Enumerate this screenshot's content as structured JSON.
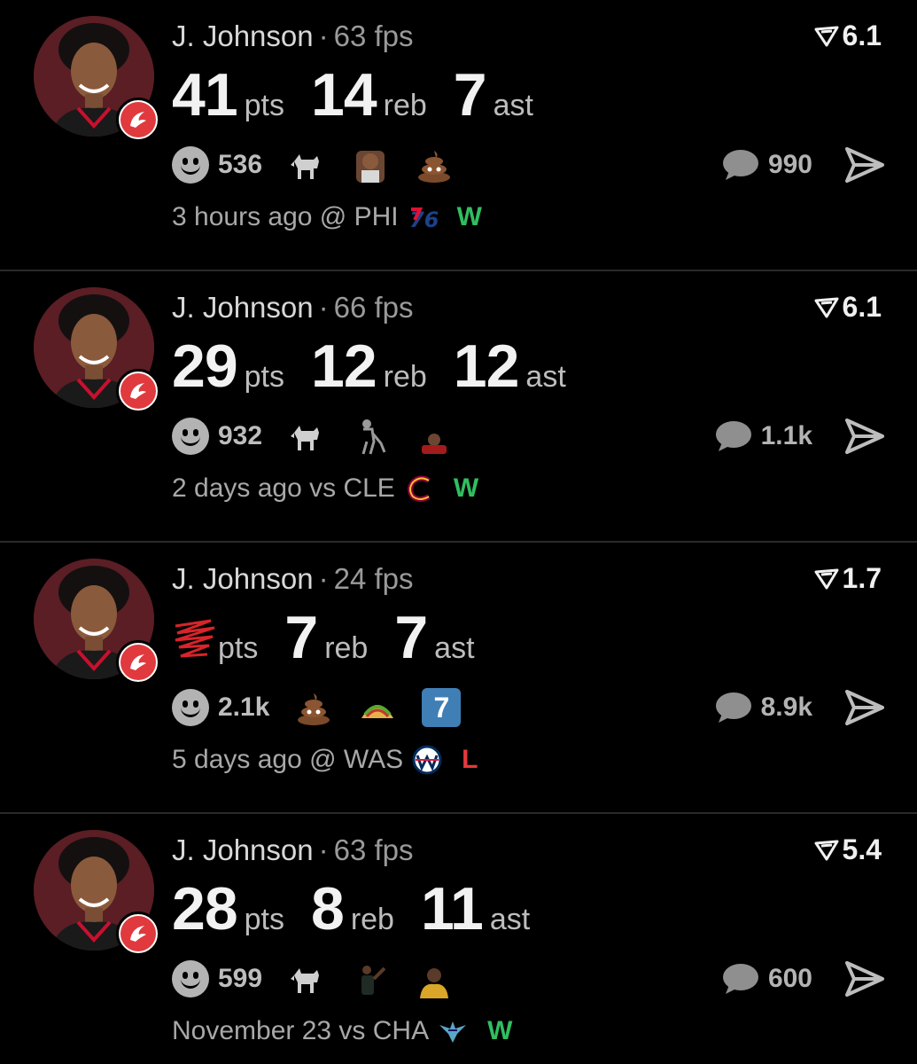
{
  "posts": [
    {
      "player": "J. Johnson",
      "sep": "·",
      "fps": "63 fps",
      "rating": "6.1",
      "pts": "41",
      "reb": "14",
      "ast": "7",
      "pts_label": "pts",
      "reb_label": "reb",
      "ast_label": "ast",
      "pts_hidden": false,
      "reaction_count": "536",
      "emojis": [
        "goat-icon",
        "crying-face-meme-icon",
        "poop-emoji-icon"
      ],
      "comments": "990",
      "time": "3 hours ago @ PHI",
      "opponent_logo": "sixers-logo-icon",
      "opponent_logo_text": "76",
      "result": "W"
    },
    {
      "player": "J. Johnson",
      "sep": "·",
      "fps": "66 fps",
      "rating": "6.1",
      "pts": "29",
      "reb": "12",
      "ast": "12",
      "pts_label": "pts",
      "reb_label": "reb",
      "ast_label": "ast",
      "pts_hidden": false,
      "reaction_count": "932",
      "emojis": [
        "goat-icon",
        "old-man-cane-icon",
        "player-meme-icon"
      ],
      "comments": "1.1k",
      "time": "2 days ago vs CLE",
      "opponent_logo": "cavaliers-logo-icon",
      "opponent_logo_text": "C",
      "result": "W"
    },
    {
      "player": "J. Johnson",
      "sep": "·",
      "fps": "24 fps",
      "rating": "1.7",
      "pts": "",
      "reb": "7",
      "ast": "7",
      "pts_label": "pts",
      "reb_label": "reb",
      "ast_label": "ast",
      "pts_hidden": true,
      "reaction_count": "2.1k",
      "emojis": [
        "poop-emoji-icon",
        "taco-icon",
        "number-seven-badge-icon"
      ],
      "badge_number": "7",
      "comments": "8.9k",
      "time": "5 days ago @ WAS",
      "opponent_logo": "wizards-logo-icon",
      "opponent_logo_text": "",
      "result": "L"
    },
    {
      "player": "J. Johnson",
      "sep": "·",
      "fps": "63 fps",
      "rating": "5.4",
      "pts": "28",
      "reb": "8",
      "ast": "11",
      "pts_label": "pts",
      "reb_label": "reb",
      "ast_label": "ast",
      "pts_hidden": false,
      "reaction_count": "599",
      "emojis": [
        "goat-icon",
        "player-pointing-icon",
        "lebron-meme-icon"
      ],
      "comments": "600",
      "time": "November 23 vs CHA",
      "opponent_logo": "hornets-logo-icon",
      "opponent_logo_text": "",
      "result": "W"
    }
  ],
  "colors": {
    "background": "#000000",
    "win": "#2fbf60",
    "loss": "#e5393b",
    "hawks_red": "#e03a3e",
    "avatar_bg": "#5a1e24"
  }
}
